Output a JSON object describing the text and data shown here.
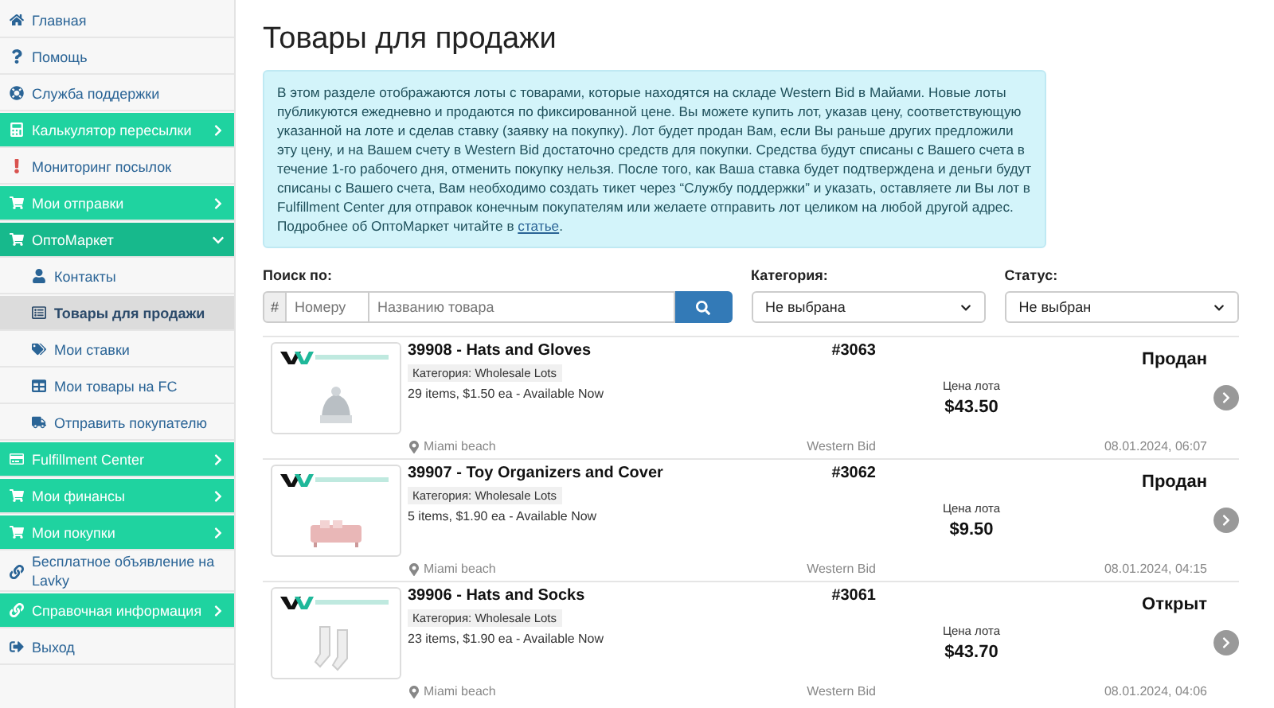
{
  "sidebar": {
    "items": [
      {
        "label": "Главная",
        "kind": "link",
        "selected": false
      },
      {
        "label": "Помощь",
        "kind": "link",
        "selected": false
      },
      {
        "label": "Служба поддержки",
        "kind": "link",
        "selected": false
      },
      {
        "label": "Калькулятор пересылки",
        "kind": "group",
        "expanded": false
      },
      {
        "label": "Мониторинг посылок",
        "kind": "link",
        "selected": false
      },
      {
        "label": "Мои отправки",
        "kind": "group",
        "expanded": false
      },
      {
        "label": "ОптоМаркет",
        "kind": "group",
        "expanded": true,
        "children": [
          {
            "label": "Контакты",
            "selected": false
          },
          {
            "label": "Товары для продажи",
            "selected": true
          },
          {
            "label": "Мои ставки",
            "selected": false
          },
          {
            "label": "Мои товары на FC",
            "selected": false
          },
          {
            "label": "Отправить покупателю",
            "selected": false
          }
        ]
      },
      {
        "label": "Fulfillment Center",
        "kind": "group",
        "expanded": false
      },
      {
        "label": "Мои финансы",
        "kind": "group",
        "expanded": false
      },
      {
        "label": "Мои покупки",
        "kind": "group",
        "expanded": false
      },
      {
        "label": "Бесплатное объявление на Lavky",
        "kind": "link",
        "selected": false
      },
      {
        "label": "Справочная информация",
        "kind": "group",
        "expanded": false
      },
      {
        "label": "Выход",
        "kind": "link",
        "selected": false
      }
    ]
  },
  "page": {
    "title": "Товары для продажи",
    "info": {
      "text": "В этом разделе отображаются лоты с товарами, которые находятся на складе Western Bid в Майами. Новые лоты публикуются ежедневно и продаются по фиксированной цене. Вы можете купить лот, указав цену, соответствующую указанной на лоте и сделав ставку (заявку на покупку). Лот будет продан Вам, если Вы раньше других предложили эту цену, и на Вашем счету в Western Bid достаточно средств для покупки. Средства будут списаны с Вашего счета в течение 1-го рабочего дня, отменить покупку нельзя. После того, как Ваша ставка будет подтверждена и деньги будут списаны с Вашего счета, Вам необходимо создать тикет через “Службу поддержки” и указать, оставляете ли Вы лот в Fulfillment Center для отправок конечным покупателям или желаете отправить лот целиком на любой другой адрес. Подробнее об ОптоМаркет читайте в ",
      "link": "статье",
      "after": "."
    },
    "filters": {
      "search_label": "Поиск по:",
      "hash": "#",
      "number_placeholder": "Номеру",
      "name_placeholder": "Названию товара",
      "category_label": "Категория:",
      "category_value": "Не выбрана",
      "status_label": "Статус:",
      "status_value": "Не выбран"
    },
    "lots": [
      {
        "title": "39908 - Hats and Gloves",
        "number": "#3063",
        "category": "Категория: Wholesale Lots",
        "details": "29 items, $1.50 ea - Available Now",
        "price_label": "Цена лота",
        "price": "$43.50",
        "status": "Продан",
        "location": "Miami beach",
        "seller": "Western Bid",
        "date": "08.01.2024, 06:07",
        "kind": "hat"
      },
      {
        "title": "39907 - Toy Organizers and Cover",
        "number": "#3062",
        "category": "Категория: Wholesale Lots",
        "details": "5 items, $1.90 ea - Available Now",
        "price_label": "Цена лота",
        "price": "$9.50",
        "status": "Продан",
        "location": "Miami beach",
        "seller": "Western Bid",
        "date": "08.01.2024, 04:15",
        "kind": "sofa"
      },
      {
        "title": "39906 - Hats and Socks",
        "number": "#3061",
        "category": "Категория: Wholesale Lots",
        "details": "23 items, $1.90 ea - Available Now",
        "price_label": "Цена лота",
        "price": "$43.70",
        "status": "Открыт",
        "location": "Miami beach",
        "seller": "Western Bid",
        "date": "08.01.2024, 04:06",
        "kind": "socks"
      }
    ]
  }
}
